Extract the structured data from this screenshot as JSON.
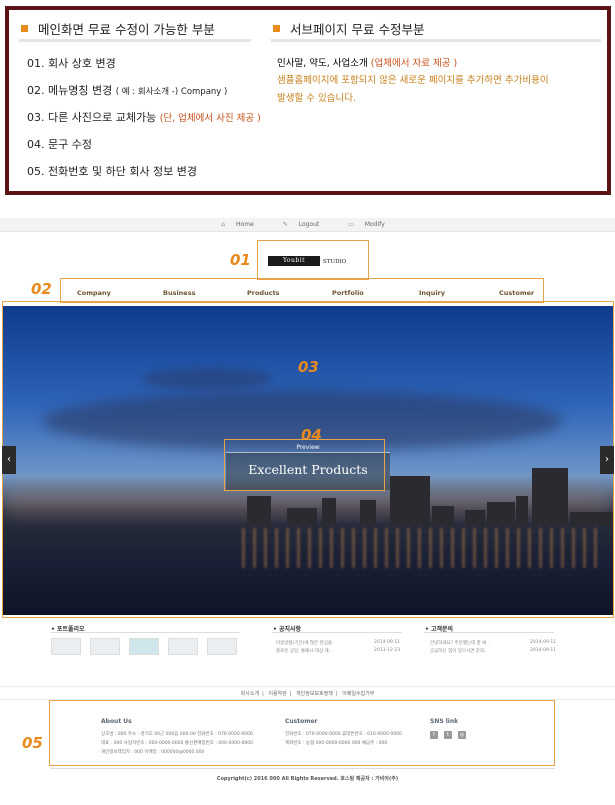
{
  "main_section": {
    "title": "메인화면 무료 수정이 가능한 부분",
    "items": [
      {
        "text": "01. 회사 상호 변경"
      },
      {
        "text": "02. 메뉴명칭 변경",
        "note": "( 예 : 회사소개 -) Company )"
      },
      {
        "text": "03. 다른 사진으로 교체가능",
        "highlight": "(단, 업체에서 사진 제공 )"
      },
      {
        "text": "04.  문구 수정"
      },
      {
        "text": "05.  전화번호 및 하단 회사 정보 변경"
      }
    ]
  },
  "sub_section": {
    "title": "서브페이지 무료 수정부분",
    "line1": "인사말, 약도, 사업소개",
    "line1_highlight": "(업체에서 자료 제공 )",
    "line2": "샘플홈페이지에 포함되지 않은 새로운 페이지를 추가하면 추가비용이",
    "line3": "발생할 수 있습니다."
  },
  "topbar": {
    "home": "Home",
    "logout": "Logout",
    "modify": "Modify"
  },
  "badges": {
    "b01": "01",
    "b02": "02",
    "b03": "03",
    "b04": "04",
    "b05": "05"
  },
  "logo": {
    "name": "Youbit",
    "suffix": "STUDIO"
  },
  "nav": [
    "Company",
    "Business",
    "Products",
    "Portfolio",
    "Inquiry",
    "Customer"
  ],
  "hero": {
    "preview_label": "Preview",
    "title": "Excellent Products",
    "prev": "‹",
    "next": "›"
  },
  "columns": {
    "portfolio": "포트폴리오",
    "notice": "공지사항",
    "inquiry": "고객문의"
  },
  "notices": [
    {
      "title": "이용방법(기안)에 많은 관심을",
      "date": "2014-09-11"
    },
    {
      "title": "홈로운 곳당, 통례사 대상 개..",
      "date": "2013-12-23"
    }
  ],
  "inquiries": [
    {
      "title": "안녕하세요? 주문했는데 잘 봐..",
      "date": "2014-09-11"
    },
    {
      "title": "궁금하신 점이 있으시면 문의..",
      "date": "2014-09-11"
    }
  ],
  "footer_links": [
    "회사소개",
    "이용약관",
    "개인정보보호정책",
    "이메일수집거부"
  ],
  "footer": {
    "about_title": "About Us",
    "about_lines": [
      "상호명 : 000   주소 : 경기도 00군 000읍 000-00   전화번호 : 070-0000-0000",
      "대표 : 000   사업자번호 : 000-0000-0000   통신판매업번호 : 000-0000-0000",
      "개인정보책임자 : 000   이메일 : 000000@0000.000"
    ],
    "customer_title": "Customer",
    "customer_lines": [
      "전화번호 : 070-0000-0000   휴대폰번호 : 010-0000-0000",
      "계좌번호 : 농협 000-0000-0000 000 예금주 : 000"
    ],
    "sns_title": "SNS link",
    "copyright": "Copyright(c) 2016 000 All Rights Reserved. 호스팅 제공자 : 가비아(주)"
  },
  "colors": {
    "frame": "#5a1418",
    "accent": "#e78b1d",
    "highlight": "#c8501a"
  }
}
